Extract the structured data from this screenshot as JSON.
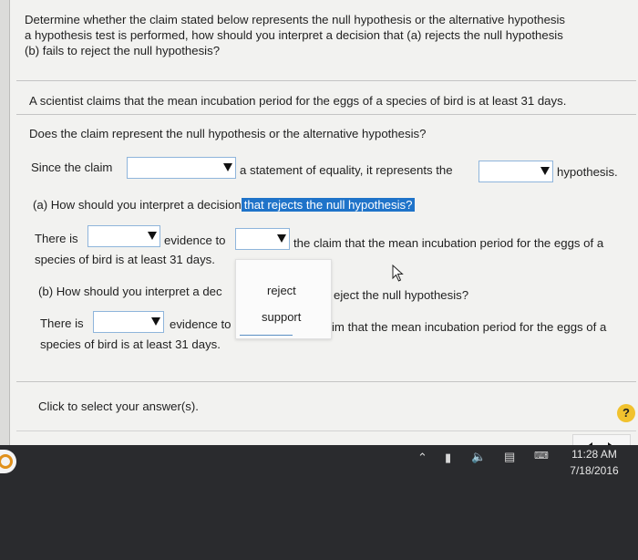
{
  "question": {
    "line1": "Determine whether the claim stated below represents the null hypothesis or the alternative hypothesis",
    "line2": "a hypothesis test is performed, how should you interpret a decision that (a) rejects the null hypothesis",
    "line3": "(b) fails to reject the null hypothesis?"
  },
  "claim": "A scientist claims that the mean incubation period for the eggs of a species of bird is at least 31 days.",
  "prompt": "Does the claim represent the null hypothesis or the alternative hypothesis?",
  "since": {
    "prefix": "Since the claim",
    "middle": "a statement of equality, it represents the",
    "suffix": "hypothesis."
  },
  "part_a": {
    "question_start": "(a) How should you interpret a decision",
    "question_highlight": "that rejects the null hypothesis?",
    "there_is": "There is",
    "evidence_to": "evidence to",
    "tail": "the claim that the mean incubation period for the eggs of a",
    "line2": "species of bird is at least 31 days."
  },
  "part_b": {
    "question_start": "(b) How should you interpret a dec",
    "question_end": "eject the null hypothesis?",
    "there_is": "There is",
    "evidence_to": "evidence to",
    "tail": "im that the mean incubation period for the eggs of a",
    "line2": "species of bird is at least 31 days."
  },
  "dropdown_options": [
    "reject",
    "support"
  ],
  "footer": "Click to select your answer(s).",
  "help_label": "?",
  "clock": {
    "time": "11:28 AM",
    "date": "7/18/2016"
  },
  "colors": {
    "highlight": "#1f73c9",
    "dropdown_border": "#8fb5db",
    "help": "#f1c22e"
  }
}
